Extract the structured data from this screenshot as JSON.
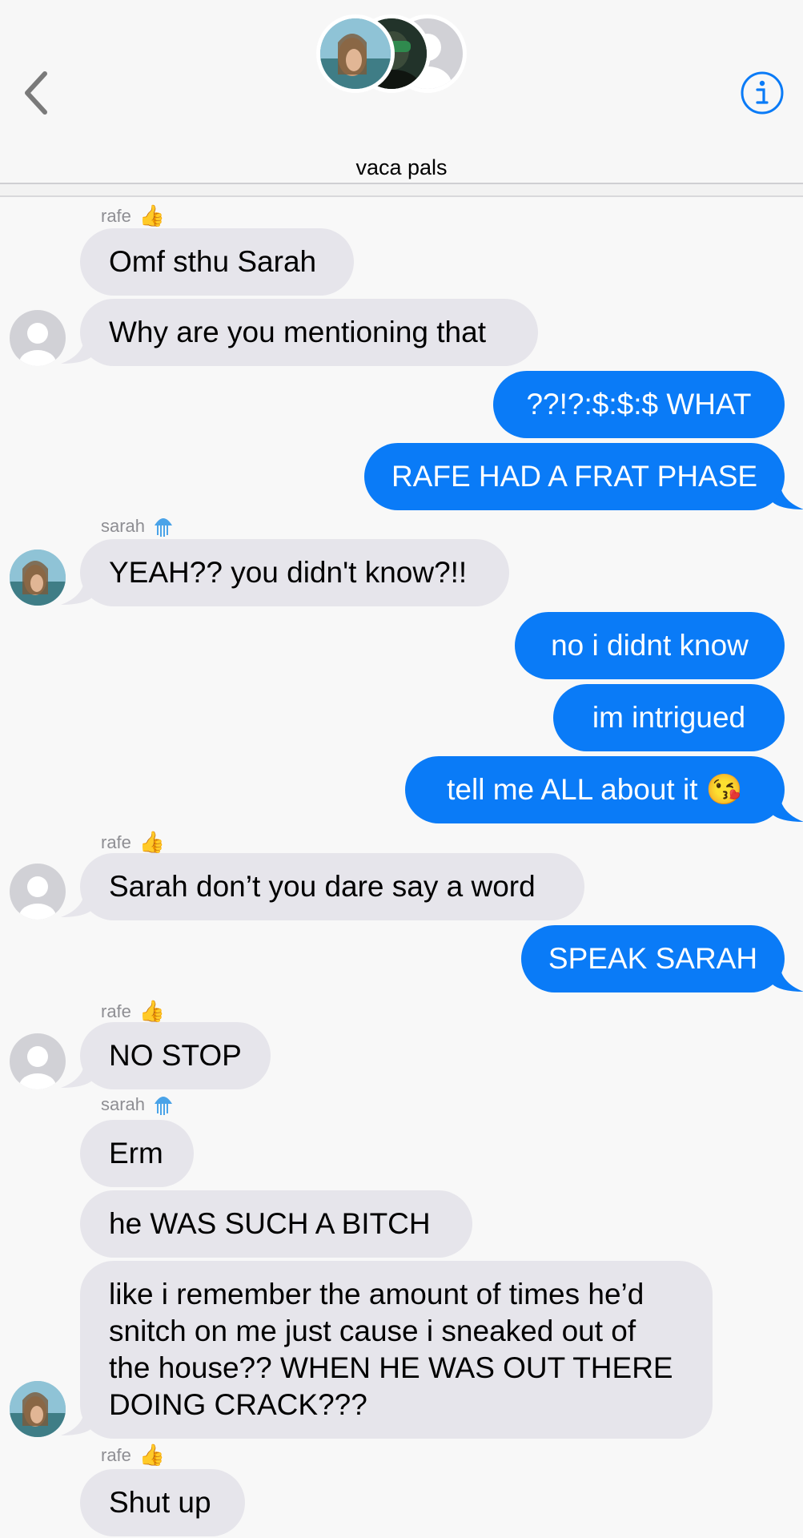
{
  "header": {
    "title": "vaca pals",
    "back_icon": "chevron-left-icon",
    "info_icon": "info-icon"
  },
  "messages": [
    {
      "id": "m1",
      "text": "Omf sthu Sarah"
    },
    {
      "id": "m2",
      "text": "Why are you mentioning that"
    },
    {
      "id": "m3",
      "text": "??!?:$:$:$ WHAT"
    },
    {
      "id": "m4",
      "text": "RAFE HAD A FRAT PHASE"
    },
    {
      "id": "m5",
      "text": "YEAH?? you didn't know?!!"
    },
    {
      "id": "m6",
      "text": "no i didnt know"
    },
    {
      "id": "m7",
      "text": "im intrigued"
    },
    {
      "id": "m8",
      "text": "tell me ALL about it 😘"
    },
    {
      "id": "m9",
      "text": "Sarah don’t you dare say a word"
    },
    {
      "id": "m10",
      "text": "SPEAK SARAH"
    },
    {
      "id": "m11",
      "text": "NO STOP"
    },
    {
      "id": "m12",
      "text": "Erm"
    },
    {
      "id": "m13",
      "text": "he WAS SUCH A BITCH"
    },
    {
      "id": "m14",
      "text": "like i remember the amount of times he’d snitch on me just cause i sneaked out of the house?? WHEN HE WAS OUT THERE DOING CRACK???"
    },
    {
      "id": "m15",
      "text": "Shut up"
    }
  ],
  "senders": {
    "rafe": {
      "name": "rafe",
      "emoji": "👍",
      "emoji_icon": "thumbs-up-icon"
    },
    "sarah": {
      "name": "sarah",
      "emoji": "🪼",
      "emoji_icon": "jellyfish-icon"
    }
  },
  "colors": {
    "outgoing": "#0a7bf7",
    "incoming": "#e6e5eb",
    "accent": "#0a7bf7"
  }
}
